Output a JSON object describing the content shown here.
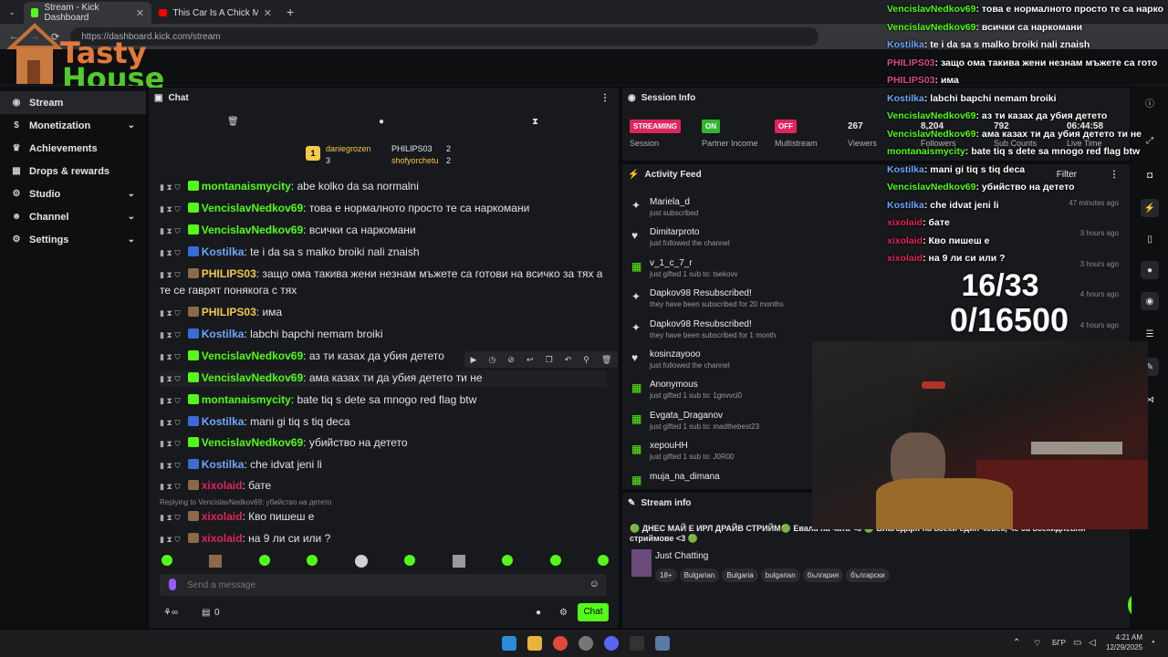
{
  "browser": {
    "tabs": [
      {
        "label": "Stream - Kick Dashboard",
        "active": true
      },
      {
        "label": "This Car Is A Chick Magnet😂",
        "active": false
      }
    ],
    "url": "https://dashboard.kick.com/stream"
  },
  "logo": {
    "line1": "Tasty",
    "line2": "House"
  },
  "sidebar": {
    "items": [
      {
        "label": "Stream",
        "active": true
      },
      {
        "label": "Monetization",
        "expandable": true
      },
      {
        "label": "Achievements"
      },
      {
        "label": "Drops & rewards"
      },
      {
        "label": "Studio",
        "expandable": true
      },
      {
        "label": "Channel",
        "expandable": true
      },
      {
        "label": "Settings",
        "expandable": true
      }
    ]
  },
  "chat": {
    "title": "Chat",
    "leaderboard": [
      {
        "rank": "1",
        "name": "daniegrozen",
        "count": "3"
      },
      {
        "name": "PHILIPS03",
        "count": "2"
      },
      {
        "name": "shofyorchetu",
        "count": "2"
      }
    ],
    "messages": [
      {
        "user": "montanaismycity",
        "color": "green",
        "text": ": abe kolko da sa normalni"
      },
      {
        "user": "VencislavNedkov69",
        "color": "green",
        "text": ": това е нормалното просто те са наркомани"
      },
      {
        "user": "VencislavNedkov69",
        "color": "green",
        "text": ": всички са наркомани"
      },
      {
        "user": "Kostilka",
        "color": "blue",
        "text": ": te i da sa s malko broiki nali znaish"
      },
      {
        "user": "PHILIPS03",
        "color": "yellow",
        "text": ": защо ома такива жени незнам мъжете са готови на всичко за тях а те се гаврят понякога с тях"
      },
      {
        "user": "PHILIPS03",
        "color": "yellow",
        "text": ": има"
      },
      {
        "user": "Kostilka",
        "color": "blue",
        "text": ": labchi bapchi nemam broiki"
      },
      {
        "user": "VencislavNedkov69",
        "color": "green",
        "text": ": аз ти казах да убия детето"
      },
      {
        "user": "VencislavNedkov69",
        "color": "green",
        "text": ": ама казах ти да убия детето ти не"
      },
      {
        "user": "montanaismycity",
        "color": "green",
        "text": ": bate tiq s dete sa mnogo red flag btw"
      },
      {
        "user": "Kostilka",
        "color": "blue",
        "text": ": mani gi tiq s tiq deca"
      },
      {
        "user": "VencislavNedkov69",
        "color": "green",
        "text": ": убийство на детето"
      },
      {
        "user": "Kostilka",
        "color": "blue",
        "text": ": che idvat jeni li"
      },
      {
        "user": "xixolaid",
        "color": "red",
        "text": ": бате"
      },
      {
        "user": "xixolaid",
        "color": "red",
        "text": ": Кво пишеш е"
      },
      {
        "user": "xixolaid",
        "color": "red",
        "text": ": на 9 ли си или ?"
      }
    ],
    "reply_note": "Replying to VencislavNedkov69: убийство на детето",
    "input_placeholder": "Send a message",
    "points": "0",
    "send_label": "Chat"
  },
  "session": {
    "title": "Session Info",
    "stats": [
      {
        "pill": "STREAMING",
        "pill_color": "#e0245e",
        "label": "Session"
      },
      {
        "pill": "ON",
        "pill_color": "#2fb82f",
        "label": "Partner Income"
      },
      {
        "pill": "OFF",
        "pill_color": "#e0245e",
        "label": "Multistream"
      },
      {
        "value": "267",
        "label": "Viewers"
      },
      {
        "value": "8,204",
        "label": "Followers"
      },
      {
        "value": "792",
        "label": "Sub Counts"
      },
      {
        "value": "06:44:58",
        "label": "Live Time"
      }
    ]
  },
  "activity": {
    "title": "Activity Feed",
    "filter": "Filter",
    "items": [
      {
        "icon": "sparkle",
        "name": "Mariela_d",
        "sub": "just subscribed",
        "time": "47 minutes ago"
      },
      {
        "icon": "heart",
        "name": "Dimitarproto",
        "sub": "just followed the channel",
        "time": "3 hours ago"
      },
      {
        "icon": "gift",
        "name": "v_1_c_7_r",
        "sub": "just gifted 1 sub to: tsekovv",
        "time": "3 hours ago"
      },
      {
        "icon": "sparkle",
        "name": "Dapkov98 Resubscribed!",
        "sub": "they have been subscribed for 20 months",
        "time": "4 hours ago"
      },
      {
        "icon": "sparkle",
        "name": "Dapkov98 Resubscribed!",
        "sub": "they have been subscribed for 1 month",
        "time": "4 hours ago"
      },
      {
        "icon": "heart",
        "name": "kosinzayooo",
        "sub": "just followed the channel",
        "time": ""
      },
      {
        "icon": "gift",
        "name": "Anonymous",
        "sub": "just gifted 1 sub to: 1gnvvci0",
        "time": ""
      },
      {
        "icon": "gift",
        "name": "Evgata_Draganov",
        "sub": "just gifted 1 sub to: madthebest23",
        "time": ""
      },
      {
        "icon": "gift",
        "name": "xepouHH",
        "sub": "just gifted 1 sub to: J0R00",
        "time": ""
      },
      {
        "icon": "gift",
        "name": "muja_na_dimana",
        "sub": "",
        "time": ""
      }
    ]
  },
  "stream_info": {
    "title": "Stream info",
    "stream_title": "🟢 ДНЕС МАЙ Е ИРЛ ДРАЙВ СТРИЙМ🟢 Евала на чата <3 🟢 Благодаря на всеки един човек, че са всекидневни стриймове <3 🟢",
    "category": "Just Chatting",
    "tags": [
      "18+",
      "Bulgarian",
      "Bulgaria",
      "bulgarian",
      "българия",
      "български"
    ]
  },
  "overlay": {
    "messages": [
      {
        "user": "VencislavNedkov69",
        "c": "g",
        "text": ": това е нормалното просто те са нарко"
      },
      {
        "user": "VencislavNedkov69",
        "c": "g",
        "text": ": всички са наркомани"
      },
      {
        "user": "Kostilka",
        "c": "b",
        "text": ": te i da sa s malko broiki nali znaish"
      },
      {
        "user": "PHILIPS03",
        "c": "p",
        "text": ": защо ома такива жени незнам мъжете са гото"
      },
      {
        "user": "PHILIPS03",
        "c": "p",
        "text": ": има"
      },
      {
        "user": "Kostilka",
        "c": "b",
        "text": ": labchi bapchi nemam broiki"
      },
      {
        "user": "VencislavNedkov69",
        "c": "g",
        "text": ": аз ти казах да убия детето"
      },
      {
        "user": "VencislavNedkov69",
        "c": "g",
        "text": ": ама казах ти да убия детето ти не"
      },
      {
        "user": "montanaismycity",
        "c": "g",
        "text": ": bate tiq s dete sa mnogo red flag btw"
      },
      {
        "user": "Kostilka",
        "c": "b",
        "text": ": mani gi tiq s tiq deca"
      },
      {
        "user": "VencislavNedkov69",
        "c": "g",
        "text": ": убийство на детето"
      },
      {
        "user": "Kostilka",
        "c": "b",
        "text": ": che idvat jeni li"
      },
      {
        "user": "xixolaid",
        "c": "r",
        "text": ": бате"
      },
      {
        "user": "xixolaid",
        "c": "r",
        "text": ": Кво пишеш е"
      },
      {
        "user": "xixolaid",
        "c": "r",
        "text": ": на 9 ли си или ?"
      }
    ],
    "counter_goal1": "16/33",
    "counter_goal2": "0/16500"
  },
  "taskbar": {
    "lang": "БГР",
    "time": "4:21 AM",
    "date": "12/29/2025"
  }
}
